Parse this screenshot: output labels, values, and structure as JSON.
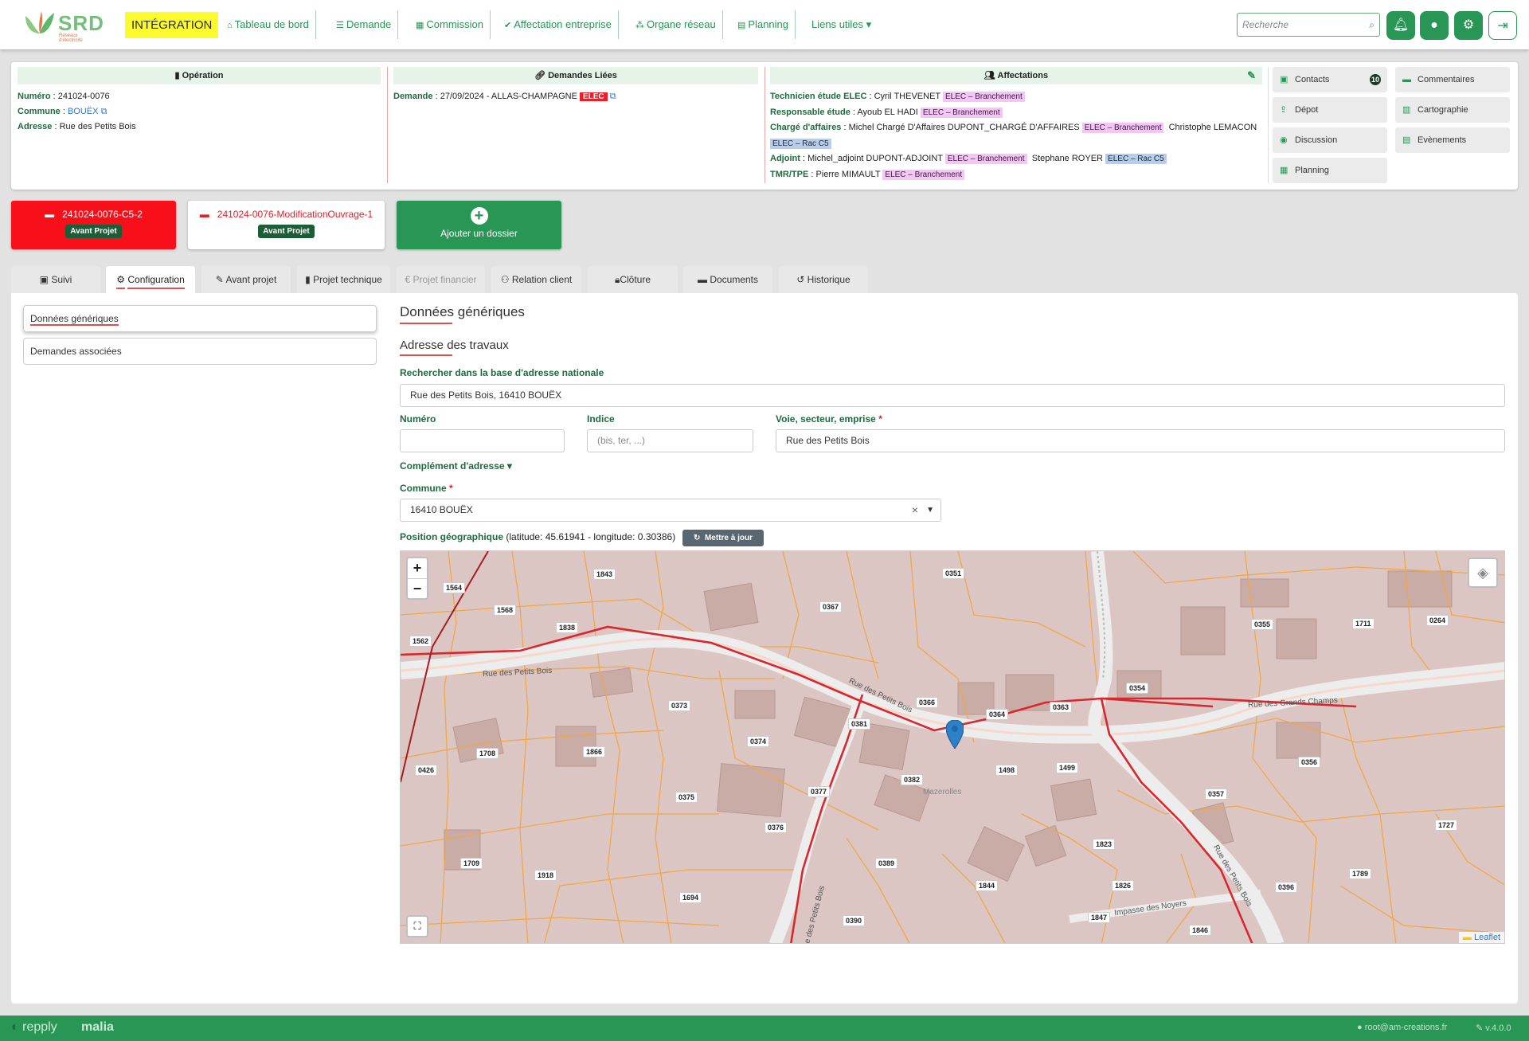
{
  "navbar": {
    "logo": "SRD",
    "logo_sub": "Réseaux d'électricité",
    "env_label": "INTÉGRATION",
    "items": [
      {
        "label": "Tableau de bord",
        "icon": "home-icon"
      },
      {
        "label": "Demande",
        "icon": "list-icon"
      },
      {
        "label": "Commission",
        "icon": "calculator-icon"
      },
      {
        "label": "Affectation entreprise",
        "icon": "clipboard-check-icon"
      },
      {
        "label": "Organe réseau",
        "icon": "sitemap-icon"
      },
      {
        "label": "Planning",
        "icon": "calendar-icon"
      },
      {
        "label": "Liens utiles ▾",
        "icon": ""
      }
    ],
    "search_placeholder": "Recherche"
  },
  "operation": {
    "title": "Opération",
    "numero_label": "Numéro",
    "numero": "241024-0076",
    "commune_label": "Commune",
    "commune": "BOUËX",
    "adresse_label": "Adresse",
    "adresse": "Rue des Petits Bois"
  },
  "demandes_liees": {
    "title": "Demandes Liées",
    "demande_label": "Demande",
    "demande": "27/09/2024 - ALLAS-CHAMPAGNE",
    "tag": "ELEC"
  },
  "affectations": {
    "title": "Affectations",
    "rows": [
      {
        "label": "Technicien étude ELEC",
        "people": [
          {
            "name": "Cyril THEVENET",
            "tag": "ELEC – Branchement",
            "kind": "br"
          }
        ]
      },
      {
        "label": "Responsable étude",
        "people": [
          {
            "name": "Ayoub EL HADI",
            "tag": "ELEC – Branchement",
            "kind": "br"
          }
        ]
      },
      {
        "label": "Chargé d'affaires",
        "people": [
          {
            "name": "Michel Chargé D'Affaires DUPONT_CHARGÉ D'AFFAIRES",
            "tag": "ELEC – Branchement",
            "kind": "br"
          },
          {
            "name": "Christophe LEMACON",
            "tag": "ELEC – Rac C5",
            "kind": "rac"
          }
        ]
      },
      {
        "label": "Adjoint",
        "people": [
          {
            "name": "Michel_adjoint DUPONT-ADJOINT",
            "tag": "ELEC – Branchement",
            "kind": "br"
          },
          {
            "name": "Stephane ROYER",
            "tag": "ELEC – Rac C5",
            "kind": "rac"
          }
        ]
      },
      {
        "label": "TMR/TPE",
        "people": [
          {
            "name": "Pierre MIMAULT",
            "tag": "ELEC – Branchement",
            "kind": "br"
          }
        ]
      }
    ]
  },
  "side_buttons": {
    "contacts": "Contacts",
    "contacts_count": "10",
    "commentaires": "Commentaires",
    "depot": "Dépot",
    "cartographie": "Cartographie",
    "discussion": "Discussion",
    "evenements": "Evènements",
    "planning": "Planning"
  },
  "dossiers": [
    {
      "title": "241024-0076-C5-2",
      "badge": "Avant Projet"
    },
    {
      "title": "241024-0076-ModificationOuvrage-1",
      "badge": "Avant Projet"
    }
  ],
  "add_dossier": "Ajouter un dossier",
  "tabs": [
    {
      "label": "Suivi",
      "icon": "briefcase-icon"
    },
    {
      "label": "Configuration",
      "icon": "cogs-icon"
    },
    {
      "label": "Avant projet",
      "icon": "pencil-icon"
    },
    {
      "label": "Projet technique",
      "icon": "file-icon"
    },
    {
      "label": "Projet financier",
      "icon": "euro-icon"
    },
    {
      "label": "Relation client",
      "icon": "people-icon"
    },
    {
      "label": "Clôture",
      "icon": "lock-icon"
    },
    {
      "label": "Documents",
      "icon": "folder-icon"
    },
    {
      "label": "Historique",
      "icon": "history-icon"
    }
  ],
  "left_nav": [
    "Données génériques",
    "Demandes associées"
  ],
  "form": {
    "title": "Données génériques",
    "subtitle": "Adresse des travaux",
    "search_label": "Rechercher dans la base d'adresse nationale",
    "search_value": "Rue des Petits Bois, 16410 BOUËX",
    "numero_label": "Numéro",
    "indice_label": "Indice",
    "indice_placeholder": "(bis, ter, ...)",
    "voie_label": "Voie, secteur, emprise",
    "voie_value": "Rue des Petits Bois",
    "complement_label": "Complément d'adresse",
    "commune_label": "Commune",
    "commune_value": "16410 BOUËX",
    "geo_label": "Position géographique",
    "geo_value": "(latitude: 45.61941 - longitude: 0.30386)",
    "refresh_label": "Mettre à jour"
  },
  "map": {
    "attribution": "Leaflet",
    "streets": [
      "Rue des Petits Bois",
      "Rue des Petits Bois",
      "Rue des Grands Champs",
      "Mazerolles",
      "Impasse des Noyers",
      "Rue des Petits Bois",
      "Rue des Petits Bois"
    ],
    "parcels": [
      "1843",
      "0351",
      "1564",
      "1568",
      "1838",
      "0367",
      "0355",
      "1711",
      "0264",
      "1562",
      "0354",
      "0373",
      "0366",
      "0364",
      "0363",
      "0381",
      "0374",
      "1708",
      "1866",
      "0426",
      "1498",
      "1499",
      "0356",
      "0382",
      "0375",
      "0377",
      "0357",
      "0376",
      "1727",
      "1823",
      "1709",
      "1918",
      "0389",
      "1844",
      "1826",
      "1789",
      "0396",
      "1694",
      "0390",
      "1847",
      "1846"
    ]
  },
  "footer": {
    "brand1": "repply",
    "brand2": "malia",
    "user": "root@am-creations.fr",
    "version": "v.4.0.0"
  }
}
